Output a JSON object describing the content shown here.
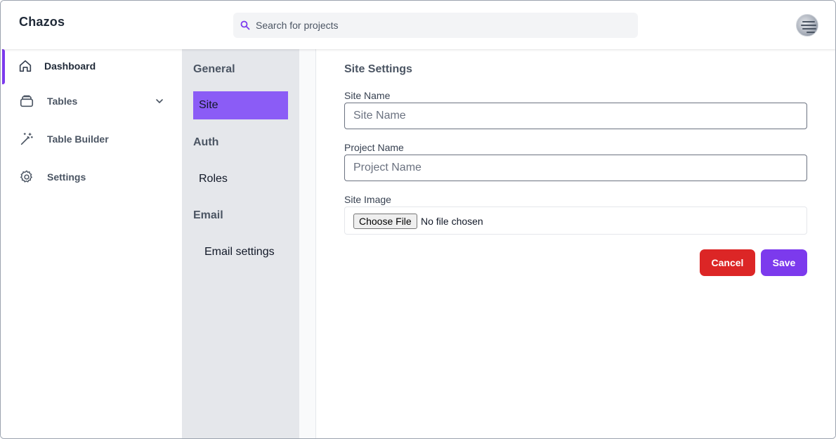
{
  "app": {
    "brand": "Chazos"
  },
  "search": {
    "placeholder": "Search for projects",
    "icon": "search-icon"
  },
  "sidebar": {
    "items": [
      {
        "label": "Dashboard",
        "icon": "home-icon",
        "active": true
      },
      {
        "label": "Tables",
        "icon": "stack-icon",
        "expandable": true
      },
      {
        "label": "Table Builder",
        "icon": "magic-wand-icon"
      },
      {
        "label": "Settings",
        "icon": "gear-icon"
      }
    ]
  },
  "settings_nav": {
    "general_heading": "General",
    "site": "Site",
    "auth_heading": "Auth",
    "roles": "Roles",
    "email_heading": "Email",
    "email_settings": "Email settings"
  },
  "form": {
    "title": "Site Settings",
    "site_name_label": "Site Name",
    "site_name_placeholder": "Site Name",
    "site_name_value": "",
    "project_name_label": "Project Name",
    "project_name_placeholder": "Project Name",
    "project_name_value": "",
    "site_image_label": "Site Image",
    "choose_file_label": "Choose File",
    "no_file_text": "No file chosen",
    "cancel_label": "Cancel",
    "save_label": "Save"
  },
  "colors": {
    "accent": "#7c3aed",
    "active_subnav": "#8b5cf6",
    "cancel": "#dc2626",
    "subnav_bg": "#e5e7eb"
  }
}
